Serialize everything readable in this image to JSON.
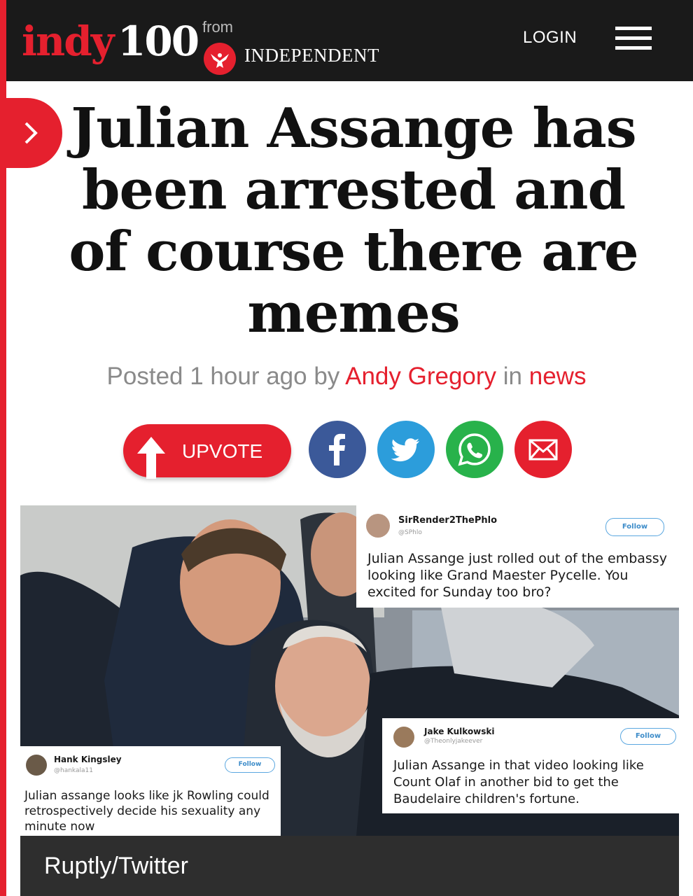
{
  "header": {
    "logo_indy": "indy",
    "logo_100": "100",
    "logo_from": "from",
    "logo_publisher": "INDEPENDENT",
    "login_label": "LOGIN"
  },
  "article": {
    "headline": "Julian Assange has been arrested and of course there are memes",
    "byline": {
      "posted_prefix": "Posted ",
      "time": "1 hour ago",
      "by": " by ",
      "author": "Andy Gregory",
      "in": " in ",
      "section": "news"
    }
  },
  "actions": {
    "upvote_label": "UPVOTE",
    "share": [
      "facebook-icon",
      "twitter-icon",
      "whatsapp-icon",
      "email-icon"
    ]
  },
  "image": {
    "tweets": [
      {
        "name": "SirRender2ThePhlo",
        "handle": "@SPhlo",
        "follow": "Follow",
        "text": "Julian Assange just rolled out of the embassy looking like Grand Maester Pycelle. You excited for Sunday too bro?"
      },
      {
        "name": "Hank Kingsley",
        "handle": "@hankala11",
        "follow": "Follow",
        "text": "Julian assange looks like jk Rowling could retrospectively decide his sexuality any minute now"
      },
      {
        "name": "Jake Kulkowski",
        "handle": "@Theonlyjakeever",
        "follow": "Follow",
        "text": "Julian Assange in that video looking like Count Olaf in another bid to get the Baudelaire children's fortune."
      }
    ],
    "caption": "Ruptly/Twitter"
  },
  "colors": {
    "brand_red": "#e5202e",
    "header_bg": "#1a1a1a",
    "facebook": "#3b5999",
    "twitter": "#2c9ddb",
    "whatsapp": "#28b24b"
  }
}
